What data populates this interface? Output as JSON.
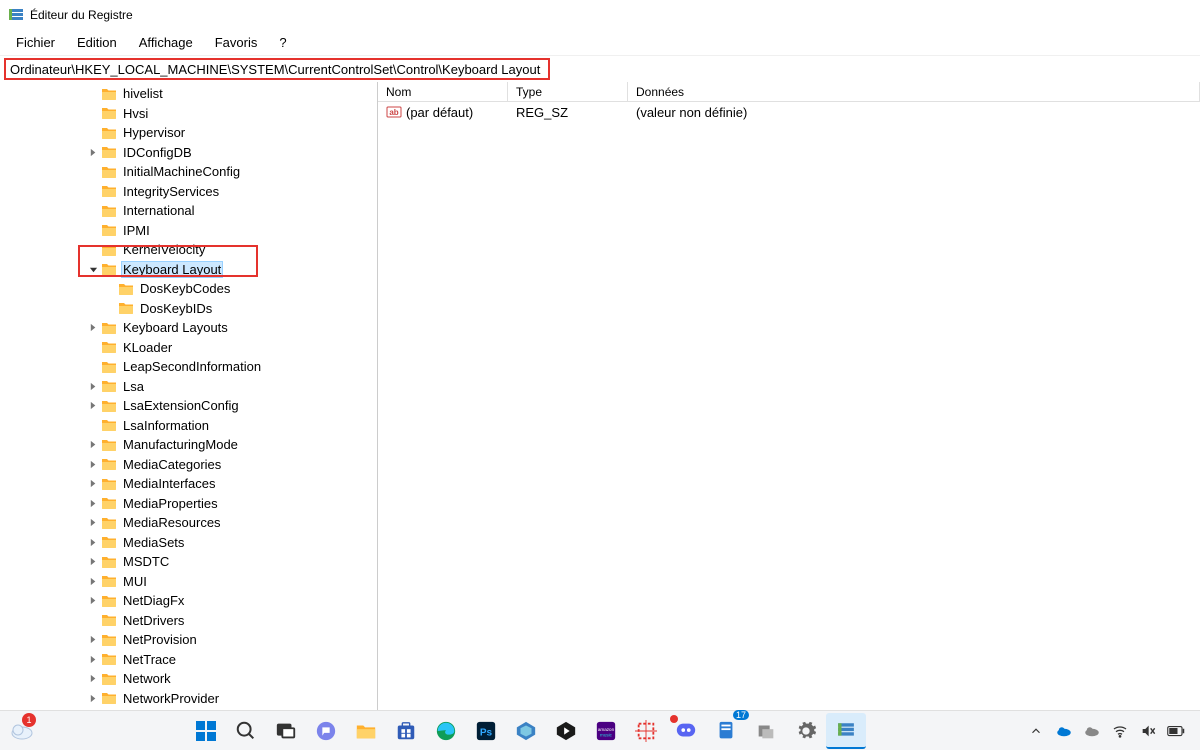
{
  "window": {
    "title": "Éditeur du Registre"
  },
  "menu": {
    "file": "Fichier",
    "edit": "Edition",
    "view": "Affichage",
    "favorites": "Favoris",
    "help": "?"
  },
  "address_bar": {
    "path": "Ordinateur\\HKEY_LOCAL_MACHINE\\SYSTEM\\CurrentControlSet\\Control\\Keyboard Layout"
  },
  "tree": {
    "items": [
      {
        "label": "hivelist",
        "indent": 5,
        "expander": ""
      },
      {
        "label": "Hvsi",
        "indent": 5,
        "expander": ""
      },
      {
        "label": "Hypervisor",
        "indent": 5,
        "expander": ""
      },
      {
        "label": "IDConfigDB",
        "indent": 5,
        "expander": ">"
      },
      {
        "label": "InitialMachineConfig",
        "indent": 5,
        "expander": ""
      },
      {
        "label": "IntegrityServices",
        "indent": 5,
        "expander": ""
      },
      {
        "label": "International",
        "indent": 5,
        "expander": ""
      },
      {
        "label": "IPMI",
        "indent": 5,
        "expander": ""
      },
      {
        "label": "KernelVelocity",
        "indent": 5,
        "expander": ""
      },
      {
        "label": "Keyboard Layout",
        "indent": 5,
        "expander": "v",
        "selected": true,
        "highlighted": true
      },
      {
        "label": "DosKeybCodes",
        "indent": 6,
        "expander": ""
      },
      {
        "label": "DosKeybIDs",
        "indent": 6,
        "expander": ""
      },
      {
        "label": "Keyboard Layouts",
        "indent": 5,
        "expander": ">"
      },
      {
        "label": "KLoader",
        "indent": 5,
        "expander": ""
      },
      {
        "label": "LeapSecondInformation",
        "indent": 5,
        "expander": ""
      },
      {
        "label": "Lsa",
        "indent": 5,
        "expander": ">"
      },
      {
        "label": "LsaExtensionConfig",
        "indent": 5,
        "expander": ">"
      },
      {
        "label": "LsaInformation",
        "indent": 5,
        "expander": ""
      },
      {
        "label": "ManufacturingMode",
        "indent": 5,
        "expander": ">"
      },
      {
        "label": "MediaCategories",
        "indent": 5,
        "expander": ">"
      },
      {
        "label": "MediaInterfaces",
        "indent": 5,
        "expander": ">"
      },
      {
        "label": "MediaProperties",
        "indent": 5,
        "expander": ">"
      },
      {
        "label": "MediaResources",
        "indent": 5,
        "expander": ">"
      },
      {
        "label": "MediaSets",
        "indent": 5,
        "expander": ">"
      },
      {
        "label": "MSDTC",
        "indent": 5,
        "expander": ">"
      },
      {
        "label": "MUI",
        "indent": 5,
        "expander": ">"
      },
      {
        "label": "NetDiagFx",
        "indent": 5,
        "expander": ">"
      },
      {
        "label": "NetDrivers",
        "indent": 5,
        "expander": ""
      },
      {
        "label": "NetProvision",
        "indent": 5,
        "expander": ">"
      },
      {
        "label": "NetTrace",
        "indent": 5,
        "expander": ">"
      },
      {
        "label": "Network",
        "indent": 5,
        "expander": ">"
      },
      {
        "label": "NetworkProvider",
        "indent": 5,
        "expander": ">"
      }
    ]
  },
  "values": {
    "header": {
      "name": "Nom",
      "type": "Type",
      "data": "Données"
    },
    "rows": [
      {
        "icon": "string-value-icon",
        "name": "(par défaut)",
        "type": "REG_SZ",
        "data": "(valeur non définie)"
      }
    ]
  },
  "taskbar": {
    "weather_badge": "1",
    "tips_badge": "17"
  }
}
